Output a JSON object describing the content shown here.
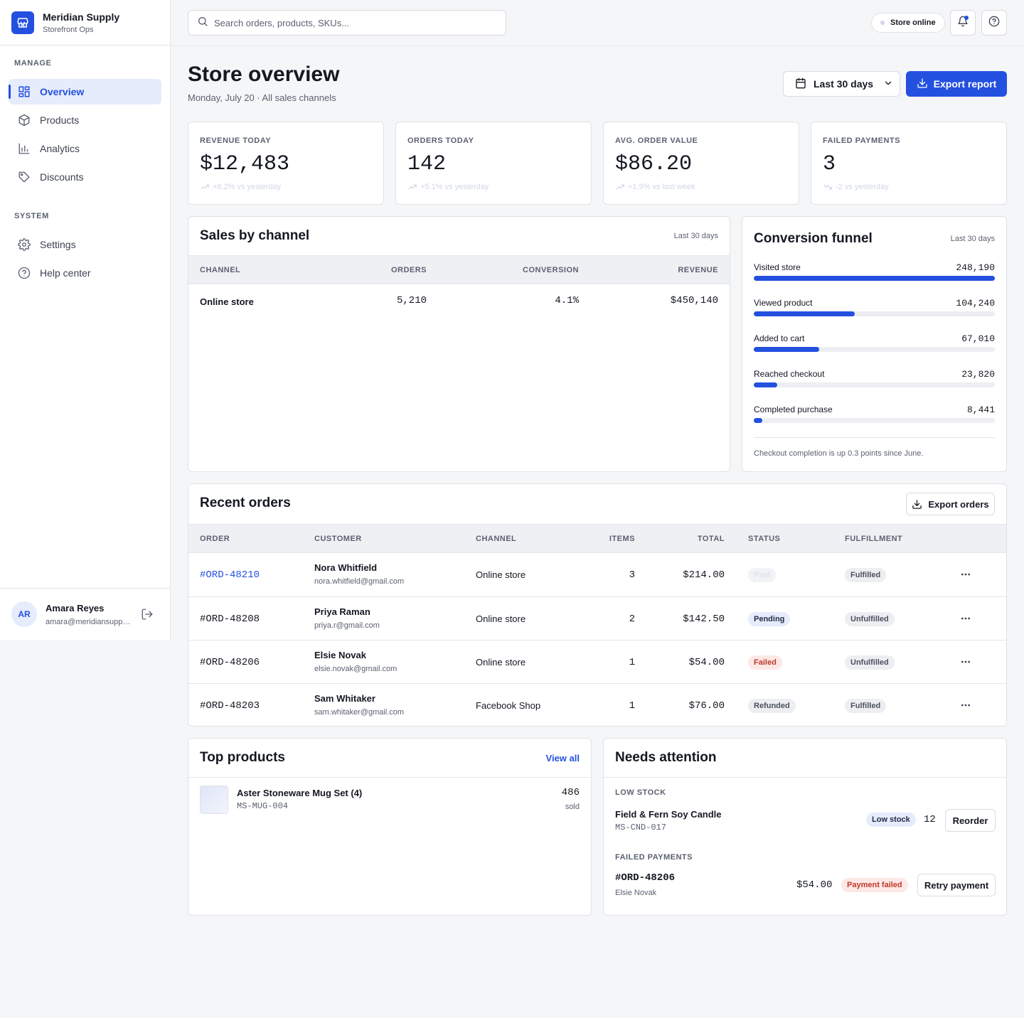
{
  "brand": {
    "name": "Meridian Supply",
    "subtitle": "Storefront Ops"
  },
  "nav": {
    "manage_label": "MANAGE",
    "system_label": "SYSTEM",
    "items": [
      {
        "label": "Overview",
        "icon": "grid-icon"
      },
      {
        "label": "Products",
        "icon": "box-icon"
      },
      {
        "label": "Analytics",
        "icon": "bar-chart-icon"
      },
      {
        "label": "Discounts",
        "icon": "tag-icon"
      },
      {
        "label": "Settings",
        "icon": "gear-icon"
      },
      {
        "label": "Help center",
        "icon": "help-icon"
      }
    ]
  },
  "user": {
    "initials": "AR",
    "name": "Amara Reyes",
    "email": "amara@meridiansupply.com"
  },
  "topbar": {
    "search_placeholder": "Search orders, products, SKUs...",
    "store_status": "Store online"
  },
  "header": {
    "title": "Store overview",
    "subtitle": "Monday, July 20 · All sales channels",
    "date_range": "Last 30 days",
    "export_label": "Export report"
  },
  "kpis": [
    {
      "label": "REVENUE TODAY",
      "value": "$12,483",
      "delta": "+8.2% vs yesterday"
    },
    {
      "label": "ORDERS TODAY",
      "value": "142",
      "delta": "+5.1% vs yesterday"
    },
    {
      "label": "AVG. ORDER VALUE",
      "value": "$86.20",
      "delta": "+1.9% vs last week"
    },
    {
      "label": "FAILED PAYMENTS",
      "value": "3",
      "delta": "-2 vs yesterday"
    }
  ],
  "sales_by_channel": {
    "title": "Sales by channel",
    "period": "Last 30 days",
    "columns": [
      "CHANNEL",
      "ORDERS",
      "CONVERSION",
      "REVENUE"
    ],
    "rows": [
      {
        "channel": "Online store",
        "orders": "5,210",
        "conversion": "4.1%",
        "revenue": "$450,140"
      }
    ]
  },
  "funnel": {
    "title": "Conversion funnel",
    "period": "Last 30 days",
    "steps": [
      {
        "label": "Visited store",
        "value": "248,190",
        "fraction": 1.0
      },
      {
        "label": "Viewed product",
        "value": "104,240",
        "fraction": 0.42
      },
      {
        "label": "Added to cart",
        "value": "67,010",
        "fraction": 0.27
      },
      {
        "label": "Reached checkout",
        "value": "23,820",
        "fraction": 0.096
      },
      {
        "label": "Completed purchase",
        "value": "8,441",
        "fraction": 0.034
      }
    ],
    "note": "Checkout completion is up 0.3 points since June."
  },
  "recent_orders": {
    "title": "Recent orders",
    "export_label": "Export orders",
    "columns": [
      "ORDER",
      "CUSTOMER",
      "CHANNEL",
      "ITEMS",
      "TOTAL",
      "STATUS",
      "FULFILLMENT"
    ],
    "rows": [
      {
        "id": "#ORD-48210",
        "name": "Nora Whitfield",
        "email": "nora.whitfield@gmail.com",
        "channel": "Online store",
        "items": "3",
        "total": "$214.00",
        "status": "Paid",
        "fulfillment": "Fulfilled"
      },
      {
        "id": "#ORD-48208",
        "name": "Priya Raman",
        "email": "priya.r@gmail.com",
        "channel": "Online store",
        "items": "2",
        "total": "$142.50",
        "status": "Pending",
        "fulfillment": "Unfulfilled"
      },
      {
        "id": "#ORD-48206",
        "name": "Elsie Novak",
        "email": "elsie.novak@gmail.com",
        "channel": "Online store",
        "items": "1",
        "total": "$54.00",
        "status": "Failed",
        "fulfillment": "Unfulfilled"
      },
      {
        "id": "#ORD-48203",
        "name": "Sam Whitaker",
        "email": "sam.whitaker@gmail.com",
        "channel": "Facebook Shop",
        "items": "1",
        "total": "$76.00",
        "status": "Refunded",
        "fulfillment": "Fulfilled"
      }
    ]
  },
  "top_products": {
    "title": "Top products",
    "view_all": "View all",
    "items": [
      {
        "name": "Aster Stoneware Mug Set (4)",
        "sku": "MS-MUG-004",
        "sold": "486",
        "sold_label": "sold"
      }
    ]
  },
  "needs_attention": {
    "title": "Needs attention",
    "low_stock_label": "LOW STOCK",
    "low_stock": {
      "name": "Field & Fern Soy Candle",
      "sku": "MS-CND-017",
      "badge": "Low stock",
      "qty": "12",
      "action": "Reorder"
    },
    "failed_label": "FAILED PAYMENTS",
    "failed": {
      "id": "#ORD-48206",
      "customer": "Elsie Novak",
      "amount": "$54.00",
      "badge": "Payment failed",
      "action": "Retry payment"
    }
  },
  "colors": {
    "accent": "#2450e0",
    "danger": "#c0392b",
    "background": "#f5f6f8"
  }
}
